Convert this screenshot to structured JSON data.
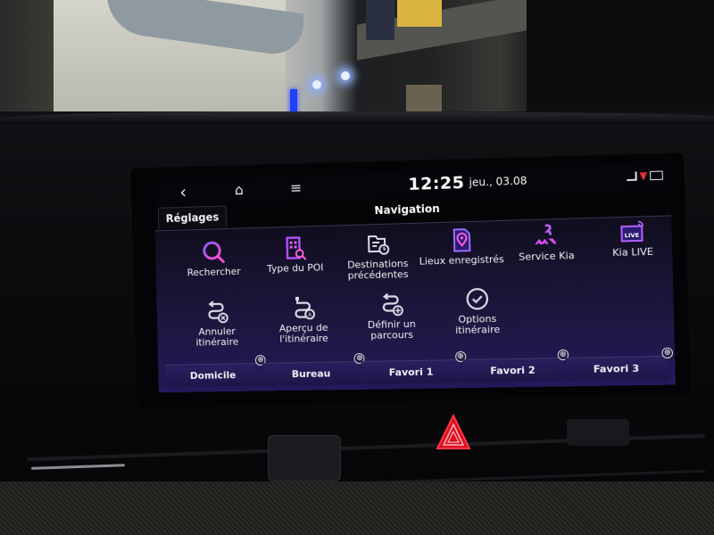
{
  "statusbar": {
    "back_icon": "‹",
    "home_icon": "⌂",
    "menu_icon": "≡",
    "time": "12:25",
    "date": "jeu., 03.08"
  },
  "header": {
    "back_tab_label": "Réglages",
    "title": "Navigation"
  },
  "menu": {
    "items": [
      {
        "label": "Rechercher",
        "icon": "search-icon"
      },
      {
        "label": "Type du POI",
        "icon": "poi-type-icon"
      },
      {
        "label": "Destinations précédentes",
        "icon": "previous-destinations-icon"
      },
      {
        "label": "Lieux enregistrés",
        "icon": "saved-places-icon"
      },
      {
        "label": "Service Kia",
        "icon": "kia-service-icon"
      },
      {
        "label": "Kia LIVE",
        "icon": "kia-live-icon"
      },
      {
        "label": "Annuler itinéraire",
        "icon": "cancel-route-icon"
      },
      {
        "label": "Aperçu de l'itinéraire",
        "icon": "route-overview-icon"
      },
      {
        "label": "Définir un parcours",
        "icon": "set-waypoints-icon"
      },
      {
        "label": "Options itinéraire",
        "icon": "route-options-icon"
      }
    ]
  },
  "favorites": {
    "items": [
      {
        "label": "Domicile"
      },
      {
        "label": "Bureau"
      },
      {
        "label": "Favori 1"
      },
      {
        "label": "Favori 2"
      },
      {
        "label": "Favori 3"
      }
    ],
    "add_icon": "⊕"
  },
  "colors": {
    "accent_pink": "#e040ff",
    "accent_purple": "#a040ff",
    "hazard_red": "#ff2233"
  }
}
